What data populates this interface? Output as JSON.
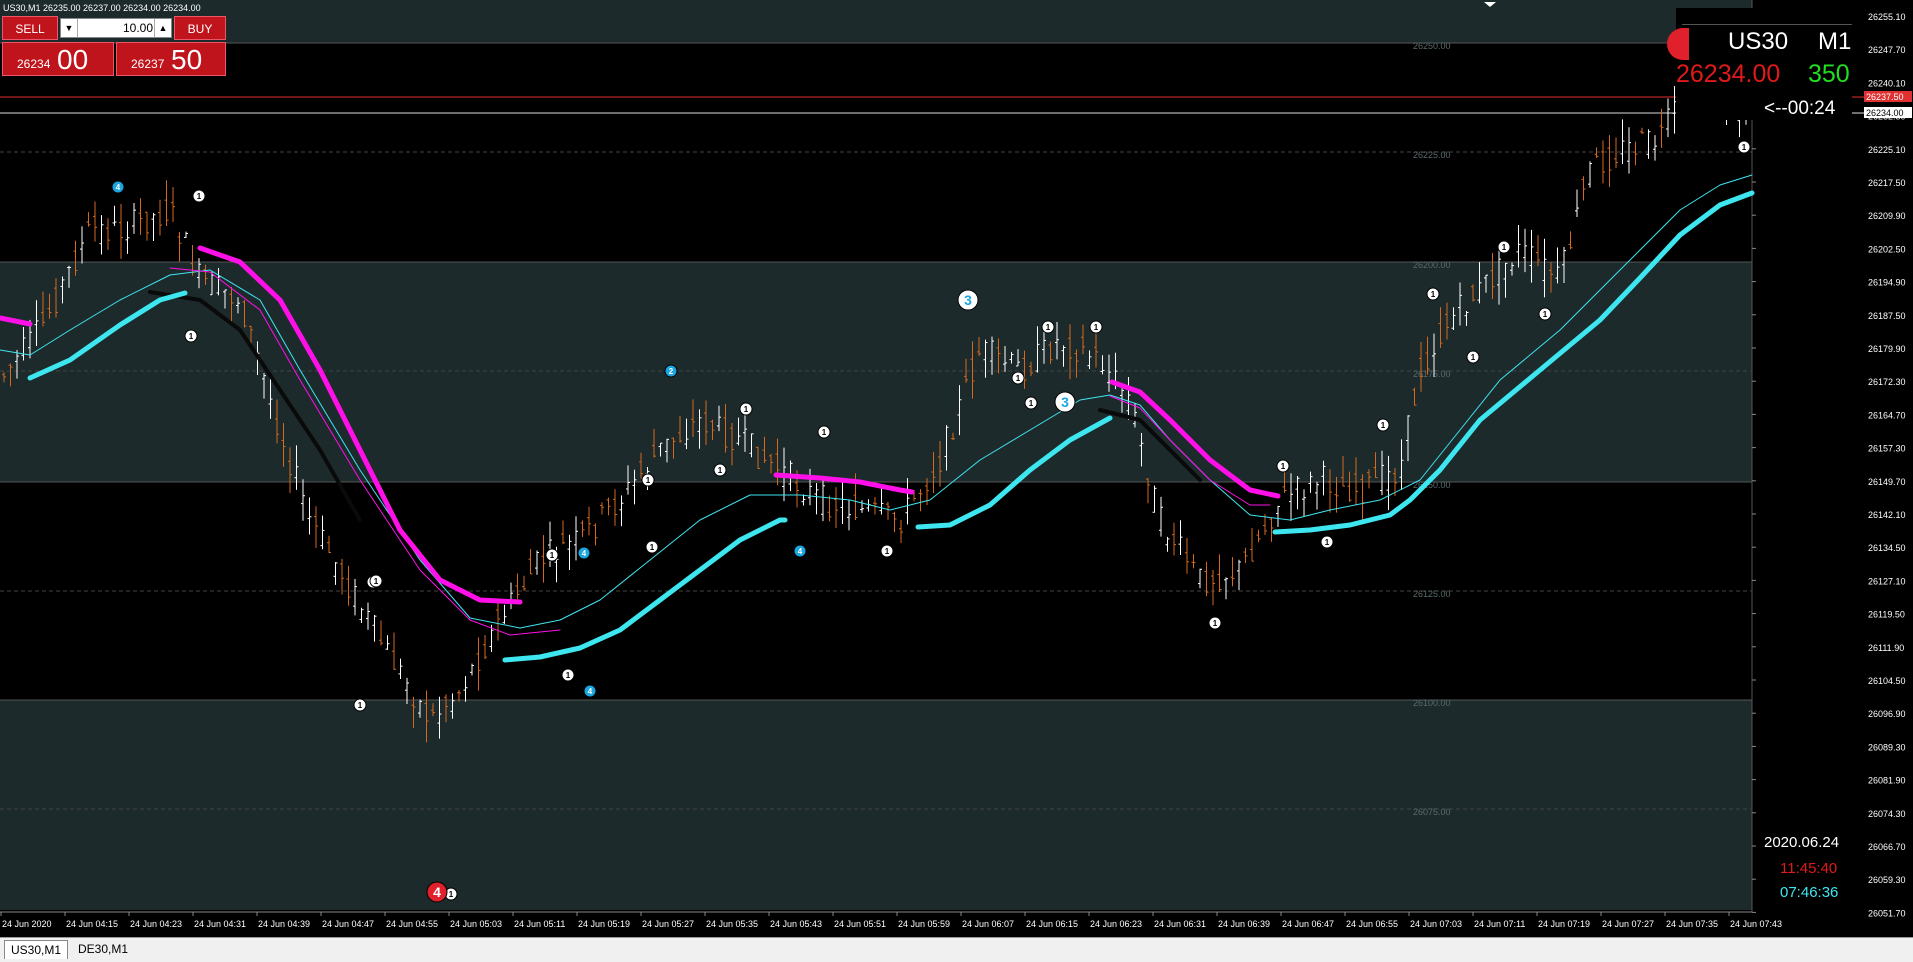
{
  "window": {
    "caption": "US30,M1  26235.00 26237.00 26234.00 26234.00"
  },
  "trade_panel": {
    "sell_label": "SELL",
    "buy_label": "BUY",
    "lot_value": "10.00",
    "sell_price_small": "26234",
    "sell_price_big": "00",
    "buy_price_small": "26237",
    "buy_price_big": "50"
  },
  "info_box": {
    "symbol": "US30",
    "timeframe": "M1",
    "price": "26234.00",
    "spread": "350",
    "countdown": "<--00:24",
    "date": "2020.06.24",
    "time_red": "11:45:40",
    "time_cyan": "07:46:36"
  },
  "colors": {
    "background": "#000000",
    "zone_fill": "#1c2a2c",
    "bull_candle": "#ffffff",
    "bear_candle": "#d2691e",
    "cyan_line": "#3ee6f0",
    "magenta_line": "#ff10e8",
    "red_line": "#e03030",
    "price_text_red": "#e01a1a",
    "spread_green": "#22dd22"
  },
  "price_axis": {
    "labels": [
      "26255.10",
      "26247.70",
      "26240.10",
      "26232.50",
      "26225.10",
      "26217.50",
      "26209.90",
      "26202.50",
      "26194.90",
      "26187.50",
      "26179.90",
      "26172.30",
      "26164.70",
      "26157.30",
      "26149.70",
      "26142.10",
      "26134.50",
      "26127.10",
      "26119.50",
      "26111.90",
      "26104.50",
      "26096.90",
      "26089.30",
      "26081.90",
      "26074.30",
      "26066.70",
      "26059.30",
      "26051.70"
    ],
    "current_ask_tag": "26237.50",
    "current_bid_tag": "26234.00"
  },
  "time_axis": {
    "labels": [
      "24 Jun 2020",
      "24 Jun 04:15",
      "24 Jun 04:23",
      "24 Jun 04:31",
      "24 Jun 04:39",
      "24 Jun 04:47",
      "24 Jun 04:55",
      "24 Jun 05:03",
      "24 Jun 05:11",
      "24 Jun 05:19",
      "24 Jun 05:27",
      "24 Jun 05:35",
      "24 Jun 05:43",
      "24 Jun 05:51",
      "24 Jun 05:59",
      "24 Jun 06:07",
      "24 Jun 06:15",
      "24 Jun 06:23",
      "24 Jun 06:31",
      "24 Jun 06:39",
      "24 Jun 06:47",
      "24 Jun 06:55",
      "24 Jun 07:03",
      "24 Jun 07:11",
      "24 Jun 07:19",
      "24 Jun 07:27",
      "24 Jun 07:35",
      "24 Jun 07:43"
    ]
  },
  "level_labels": [
    "26250.00",
    "26225.00",
    "26200.00",
    "26175.00",
    "26150.00",
    "26125.00",
    "26100.00",
    "26075.00"
  ],
  "wave_markers": [
    {
      "label": "4",
      "kind": "blue"
    },
    {
      "label": "1",
      "kind": "white"
    },
    {
      "label": "1",
      "kind": "white"
    },
    {
      "label": "1",
      "kind": "white"
    },
    {
      "label": "1",
      "kind": "white"
    },
    {
      "label": "1",
      "kind": "white"
    },
    {
      "label": "4",
      "kind": "red"
    },
    {
      "label": "1",
      "kind": "white"
    },
    {
      "label": "4",
      "kind": "blue"
    },
    {
      "label": "1",
      "kind": "white"
    },
    {
      "label": "4",
      "kind": "blue"
    },
    {
      "label": "1",
      "kind": "white"
    },
    {
      "label": "1",
      "kind": "white"
    },
    {
      "label": "2",
      "kind": "blue"
    },
    {
      "label": "1",
      "kind": "white"
    },
    {
      "label": "1",
      "kind": "white"
    },
    {
      "label": "1",
      "kind": "white"
    },
    {
      "label": "4",
      "kind": "blue"
    },
    {
      "label": "1",
      "kind": "white"
    },
    {
      "label": "1",
      "kind": "white"
    },
    {
      "label": "3",
      "kind": "white-big"
    },
    {
      "label": "1",
      "kind": "white"
    },
    {
      "label": "1",
      "kind": "white"
    },
    {
      "label": "1",
      "kind": "white"
    },
    {
      "label": "1",
      "kind": "white"
    },
    {
      "label": "3",
      "kind": "white-big"
    },
    {
      "label": "1",
      "kind": "white"
    },
    {
      "label": "1",
      "kind": "white"
    },
    {
      "label": "1",
      "kind": "white"
    },
    {
      "label": "1",
      "kind": "white"
    },
    {
      "label": "1",
      "kind": "white"
    },
    {
      "label": "1",
      "kind": "white"
    },
    {
      "label": "1",
      "kind": "white"
    },
    {
      "label": "1",
      "kind": "white"
    },
    {
      "label": "1",
      "kind": "white"
    }
  ],
  "tabs": [
    {
      "label": "US30,M1"
    },
    {
      "label": "DE30,M1"
    }
  ]
}
